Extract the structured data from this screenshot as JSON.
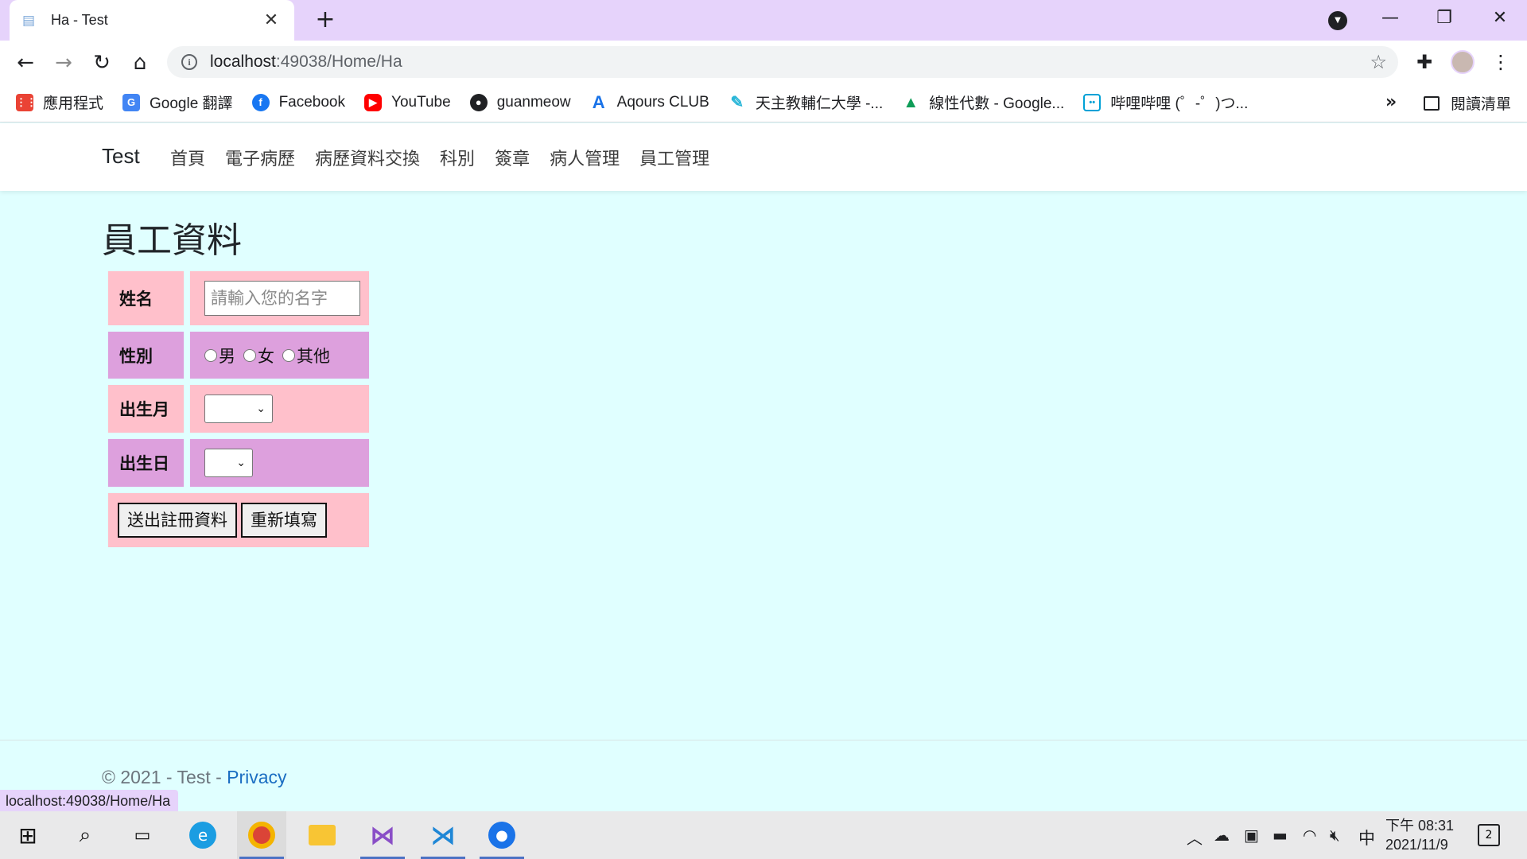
{
  "browser": {
    "tab_title": "Ha - Test",
    "url_host": "localhost",
    "url_rest": ":49038/Home/Ha",
    "status_url": "localhost:49038/Home/Ha"
  },
  "bookmarks": [
    {
      "label": "應用程式",
      "icon": "apps-grid-icon",
      "color": "#ea4335"
    },
    {
      "label": "Google 翻譯",
      "icon": "google-translate-icon",
      "color": "#4285f4"
    },
    {
      "label": "Facebook",
      "icon": "facebook-icon",
      "color": "#1877f2"
    },
    {
      "label": "YouTube",
      "icon": "youtube-icon",
      "color": "#ff0000"
    },
    {
      "label": "guanmeow",
      "icon": "github-icon",
      "color": "#202124"
    },
    {
      "label": "Aqours CLUB",
      "icon": "aqours-icon",
      "color": "#1a73e8"
    },
    {
      "label": "天主教輔仁大學 -...",
      "icon": "fju-icon",
      "color": "#29b6d8"
    },
    {
      "label": "線性代數 - Google...",
      "icon": "google-drive-icon",
      "color": "#0f9d58"
    },
    {
      "label": "哔哩哔哩 (゜-゜)つ...",
      "icon": "bilibili-icon",
      "color": "#00a1d6"
    }
  ],
  "bookmarks_more": "»",
  "reading_list": "閱讀清單",
  "site": {
    "brand": "Test",
    "nav": [
      "首頁",
      "電子病歷",
      "病歷資料交換",
      "科別",
      "簽章",
      "病人管理",
      "員工管理"
    ]
  },
  "page": {
    "title": "員工資料",
    "form": {
      "name_label": "姓名",
      "name_placeholder": "請輸入您的名字",
      "gender_label": "性別",
      "gender_options": [
        "男",
        "女",
        "其他"
      ],
      "month_label": "出生月",
      "day_label": "出生日",
      "submit_label": "送出註冊資料",
      "reset_label": "重新填寫"
    }
  },
  "footer": {
    "copyright": "© 2021 - Test - ",
    "privacy": "Privacy"
  },
  "taskbar": {
    "time": "下午 08:31",
    "date": "2021/11/9",
    "ime": "中",
    "notifications": "2"
  },
  "colors": {
    "page_bg": "#e0ffff",
    "row_pink": "#ffc0cb",
    "row_plum": "#dda0dd",
    "link": "#1b6ec2"
  }
}
